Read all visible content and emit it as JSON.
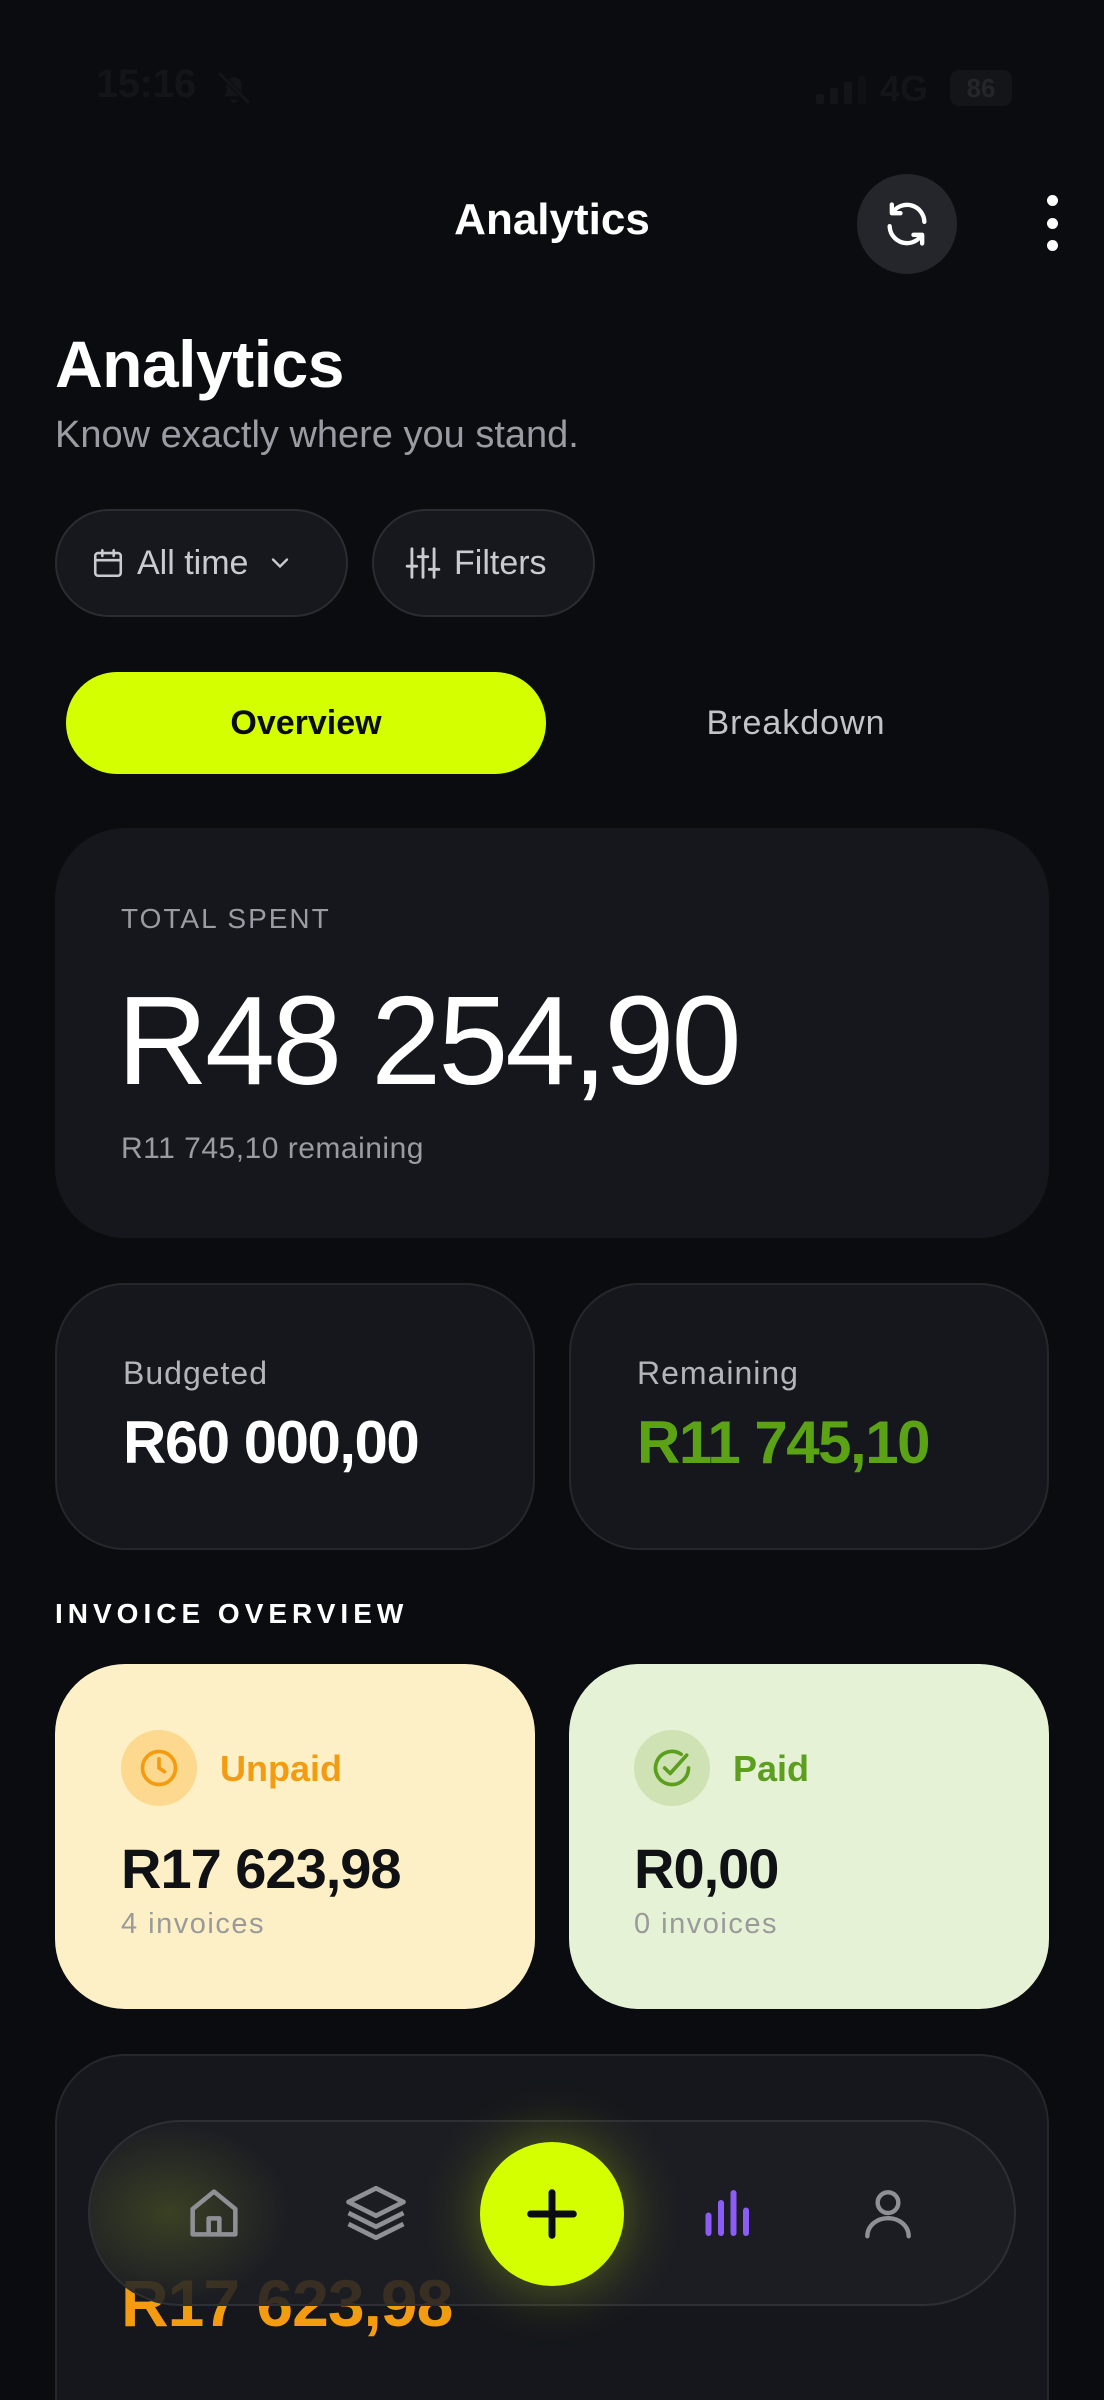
{
  "status_bar": {
    "time": "15:16",
    "network": "4G",
    "battery": "86"
  },
  "header": {
    "title": "Analytics"
  },
  "page": {
    "title": "Analytics",
    "subtitle": "Know exactly where you stand."
  },
  "filters": {
    "time_label": "All time",
    "filters_label": "Filters"
  },
  "tabs": [
    {
      "label": "Overview",
      "active": true
    },
    {
      "label": "Breakdown",
      "active": false
    }
  ],
  "total": {
    "label": "TOTAL SPENT",
    "amount": "R48 254,90",
    "remaining_text": "R11 745,10 remaining"
  },
  "stats": {
    "budgeted": {
      "label": "Budgeted",
      "value": "R60 000,00"
    },
    "remaining": {
      "label": "Remaining",
      "value": "R11 745,10"
    }
  },
  "invoice_overview": {
    "title": "INVOICE OVERVIEW",
    "unpaid": {
      "label": "Unpaid",
      "amount": "R17 623,98",
      "count": "4 invoices"
    },
    "paid": {
      "label": "Paid",
      "amount": "R0,00",
      "count": "0 invoices"
    }
  },
  "bottom_card": {
    "amount": "R17 623,98"
  },
  "nav": {
    "items": [
      "home-icon",
      "layers-icon",
      "add-icon",
      "analytics-icon",
      "profile-icon"
    ],
    "active": "analytics-icon"
  },
  "colors": {
    "accent": "#d4ff00",
    "background": "#0b0c10",
    "card": "#15171c",
    "remaining_green": "#5ba315",
    "unpaid_orange": "#f39c12",
    "paid_green": "#5c9e1e",
    "nav_active": "#8b5cf6"
  }
}
